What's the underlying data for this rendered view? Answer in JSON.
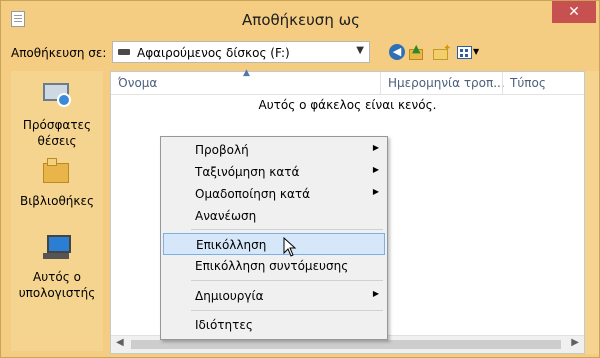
{
  "window": {
    "title": "Αποθήκευση ως",
    "close_glyph": "✕"
  },
  "toolbar": {
    "save_in_label": "Αποθήκευση σε:",
    "save_in_value": "Αφαιρούμενος δίσκος (F:)"
  },
  "places": [
    {
      "label": "Πρόσφατες θέσεις",
      "icon": "recent-places-icon"
    },
    {
      "label": "Βιβλιοθήκες",
      "icon": "libraries-icon"
    },
    {
      "label": "Αυτός ο υπολογιστής",
      "icon": "this-pc-icon"
    }
  ],
  "file_list": {
    "columns": [
      "Όνομα",
      "Ημερομηνία τροπ...",
      "Τύπος"
    ],
    "empty_message": "Αυτός ο φάκελος είναι κενός."
  },
  "context_menu": {
    "items": [
      {
        "label": "Προβολή",
        "submenu": true
      },
      {
        "label": "Ταξινόμηση κατά",
        "submenu": true
      },
      {
        "label": "Ομαδοποίηση κατά",
        "submenu": true
      },
      {
        "label": "Ανανέωση",
        "submenu": false
      },
      {
        "label": "Επικόλληση",
        "submenu": false,
        "highlighted": true
      },
      {
        "label": "Επικόλληση συντόμευσης",
        "submenu": false
      },
      {
        "label": "Δημιουργία",
        "submenu": true
      },
      {
        "label": "Ιδιότητες",
        "submenu": false
      }
    ]
  },
  "colors": {
    "frame": "#f4cd83",
    "close_button": "#c75050",
    "menu_highlight": "#d5e7f8"
  }
}
